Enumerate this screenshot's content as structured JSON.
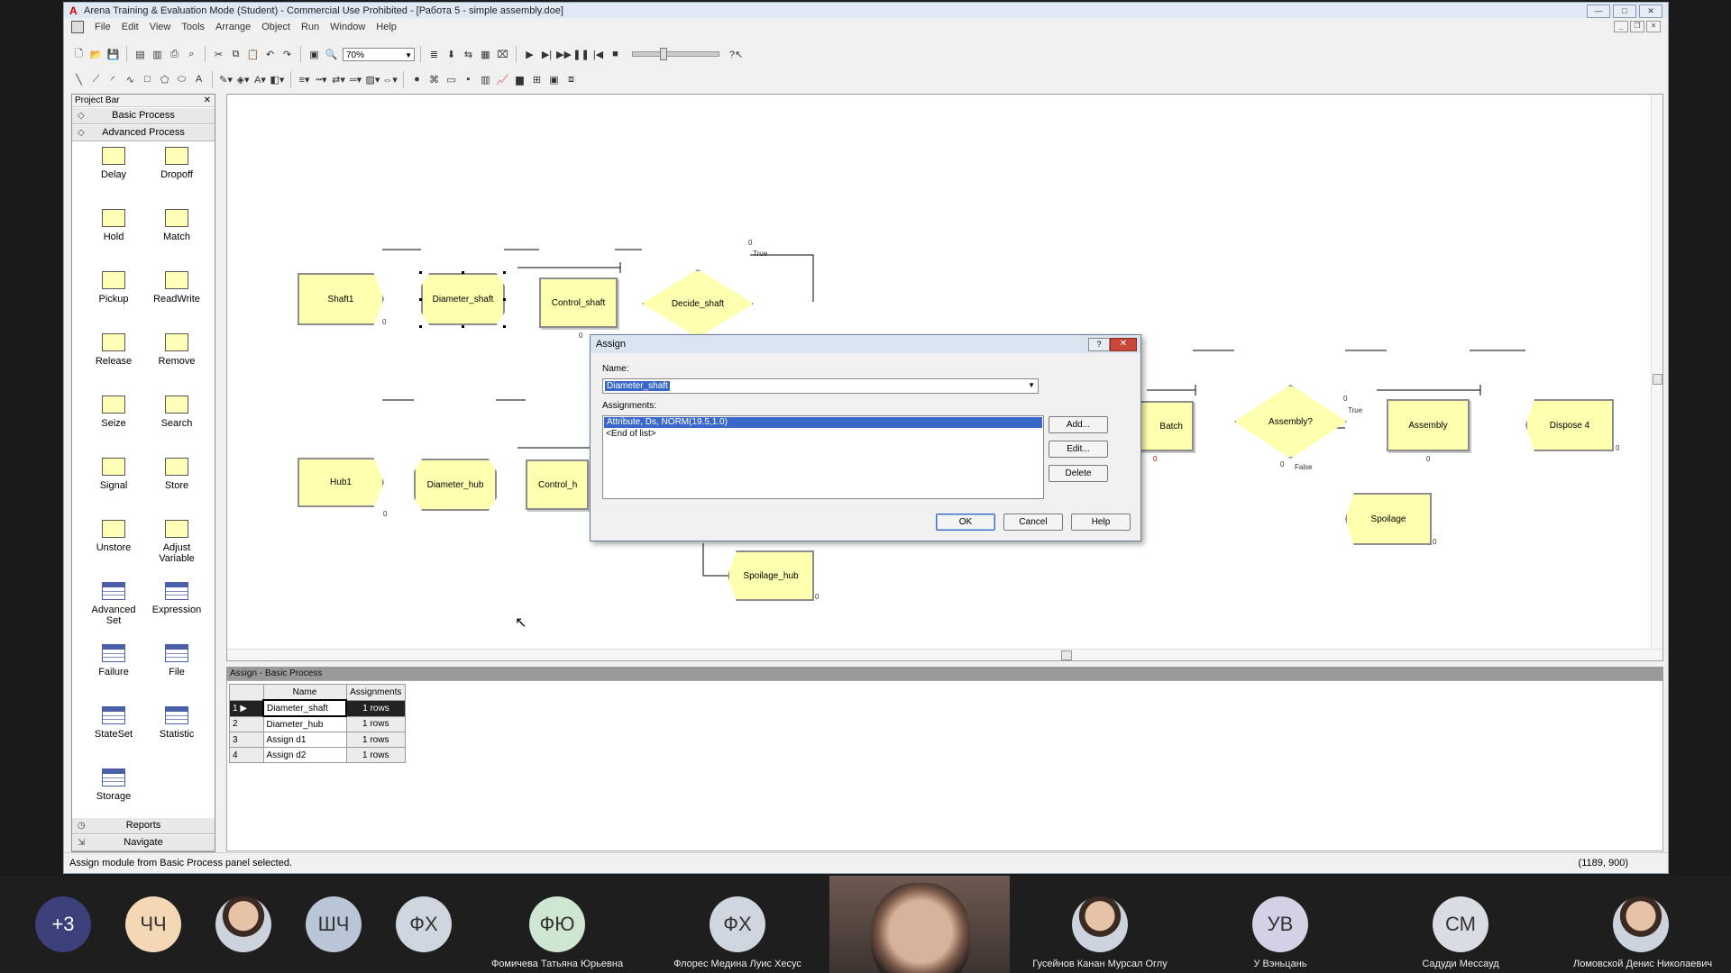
{
  "window": {
    "title": "Arena Training & Evaluation Mode (Student) - Commercial Use Prohibited - [Работа 5 - simple assembly.doe]"
  },
  "menu": [
    "File",
    "Edit",
    "View",
    "Tools",
    "Arrange",
    "Object",
    "Run",
    "Window",
    "Help"
  ],
  "toolbar": {
    "zoom": "70%"
  },
  "project_bar": {
    "title": "Project Bar",
    "panels_top": [
      "Basic Process",
      "Advanced Process"
    ],
    "modules": [
      {
        "label": "Delay",
        "icon": "module-icon"
      },
      {
        "label": "Dropoff",
        "icon": "module-icon"
      },
      {
        "label": "Hold",
        "icon": "module-icon"
      },
      {
        "label": "Match",
        "icon": "module-icon"
      },
      {
        "label": "Pickup",
        "icon": "module-icon"
      },
      {
        "label": "ReadWrite",
        "icon": "module-icon"
      },
      {
        "label": "Release",
        "icon": "module-icon"
      },
      {
        "label": "Remove",
        "icon": "module-icon"
      },
      {
        "label": "Seize",
        "icon": "module-icon"
      },
      {
        "label": "Search",
        "icon": "module-icon"
      },
      {
        "label": "Signal",
        "icon": "module-icon"
      },
      {
        "label": "Store",
        "icon": "module-icon"
      },
      {
        "label": "Unstore",
        "icon": "module-icon"
      },
      {
        "label": "Adjust Variable",
        "icon": "module-icon"
      },
      {
        "label": "Advanced Set",
        "icon": "table-icon"
      },
      {
        "label": "Expression",
        "icon": "table-icon"
      },
      {
        "label": "Failure",
        "icon": "table-icon"
      },
      {
        "label": "File",
        "icon": "table-icon"
      },
      {
        "label": "StateSet",
        "icon": "table-icon"
      },
      {
        "label": "Statistic",
        "icon": "table-icon"
      },
      {
        "label": "Storage",
        "icon": "table-icon"
      }
    ],
    "panels_bottom": [
      "Reports",
      "Navigate"
    ]
  },
  "canvas": {
    "nodes": {
      "shaft1": "Shaft1",
      "diameter_shaft": "Diameter_shaft",
      "control_shaft": "Control_shaft",
      "decide_shaft": "Decide_shaft",
      "hub1": "Hub1",
      "diameter_hub": "Diameter_hub",
      "control_hub": "Control_h",
      "batch": "Batch",
      "assembly_decide": "Assembly?",
      "assembly": "Assembly",
      "dispose4": "Dispose 4",
      "spoilage": "Spoilage",
      "spoilage_hub": "Spoilage_hub"
    },
    "labels": {
      "true1": "True",
      "true2": "True",
      "false1": "False",
      "zero": "0"
    }
  },
  "dialog": {
    "title": "Assign",
    "help_glyph": "?",
    "close_glyph": "✕",
    "name_label": "Name:",
    "name_value": "Diameter_shaft",
    "assignments_label": "Assignments:",
    "assignments": [
      "Attribute, Ds, NORM(19.5,1.0)",
      "<End of list>"
    ],
    "add": "Add...",
    "edit": "Edit...",
    "delete": "Delete",
    "ok": "OK",
    "cancel": "Cancel",
    "help": "Help"
  },
  "spreadsheet": {
    "title": "Assign - Basic Process",
    "columns": [
      "Name",
      "Assignments"
    ],
    "rows": [
      {
        "n": "1",
        "name": "Diameter_shaft",
        "assignments": "1 rows"
      },
      {
        "n": "2",
        "name": "Diameter_hub",
        "assignments": "1 rows"
      },
      {
        "n": "3",
        "name": "Assign d1",
        "assignments": "1 rows"
      },
      {
        "n": "4",
        "name": "Assign d2",
        "assignments": "1 rows"
      }
    ]
  },
  "status": {
    "message": "Assign module from Basic Process panel selected.",
    "coords": "(1189, 900)"
  },
  "participants": [
    {
      "initials": "+3",
      "color": "#3b3f7a",
      "name": ""
    },
    {
      "initials": "ЧЧ",
      "color": "#f4d7b5",
      "name": ""
    },
    {
      "initials": "",
      "color": "photo",
      "name": ""
    },
    {
      "initials": "ШЧ",
      "color": "#b9c6d8",
      "name": ""
    },
    {
      "initials": "ФХ",
      "color": "#cfd6df",
      "name": ""
    },
    {
      "initials": "ФЮ",
      "color": "#cfe6d3",
      "name": "Фомичева Татьяна Юрьевна"
    },
    {
      "initials": "ФХ",
      "color": "#cfd6df",
      "name": "Флорес Медина Луис Хесус"
    },
    {
      "initials": "",
      "color": "photo",
      "name": "Гусейнов Канан Мурсал Оглу"
    },
    {
      "initials": "УВ",
      "color": "#d4d1e6",
      "name": "У Вэньцань"
    },
    {
      "initials": "СМ",
      "color": "#d9dde3",
      "name": "Садуди Мессауд"
    },
    {
      "initials": "",
      "color": "photo",
      "name": "Ломовской Денис Николаевич"
    }
  ]
}
